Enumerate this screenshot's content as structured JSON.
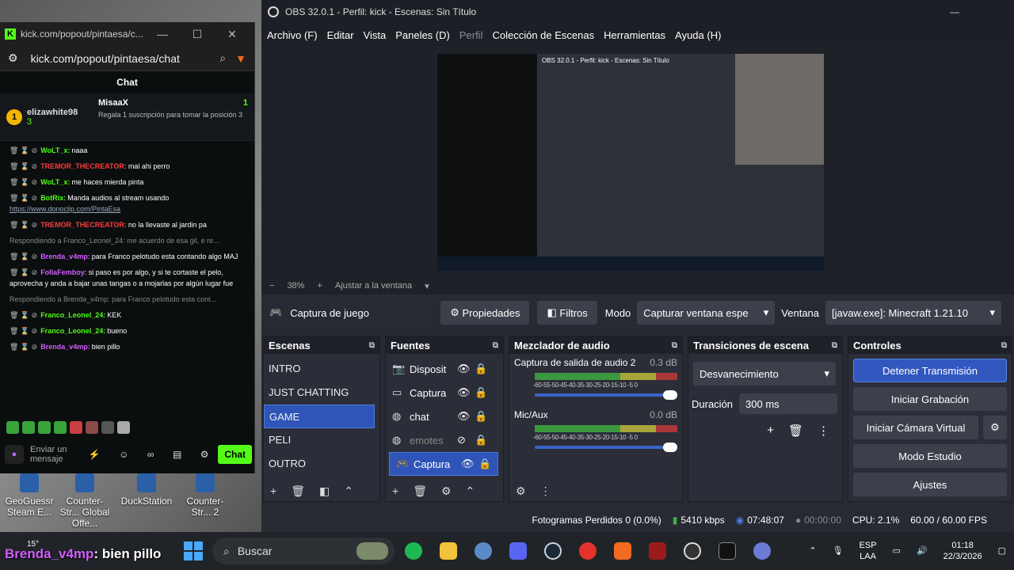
{
  "kick": {
    "window_title": "kick.com/popout/pintaesa/c...",
    "url": "kick.com/popout/pintaesa/chat",
    "chat_header": "Chat",
    "gift1": {
      "rank": "1",
      "name": "elizawhite98",
      "count": "3"
    },
    "gift2": {
      "name": "MisaaX",
      "count": "1",
      "text": "Regala 1 suscripción para tomar la posición 3"
    },
    "messages": [
      {
        "user": "WoLT_x:",
        "text": "naaa",
        "color": "#53fc18"
      },
      {
        "user": "TREMOR_THECREATOR:",
        "text": "mal ahi perro",
        "color": "#ff3b3b"
      },
      {
        "user": "WoLT_x:",
        "text": "me haces mierda pinta",
        "color": "#53fc18"
      },
      {
        "user": "BotRix:",
        "text": "Manda audios al stream usando",
        "color": "#53fc18",
        "link": "https://www.donoclip.com/PintaEsa"
      },
      {
        "user": "TREMOR_THECREATOR:",
        "text": "no la llevaste al jardin pa",
        "color": "#ff3b3b"
      },
      {
        "reply": "Respondiendo a Franco_Leonel_24: me acuerdo de esa gil, e re..."
      },
      {
        "user": "Brenda_v4mp:",
        "text": "para Franco pelotudo esta contando algo MAJ",
        "color": "#d15eff"
      },
      {
        "user": "FollaFemboy:",
        "text": "si paso es por algo, y si te cortaste el pelo, aprovecha y anda a bajar unas tangas o a mojarlas por algún lugar fue",
        "color": "#d15eff"
      },
      {
        "reply": "Respondiendo a Brenda_v4mp: para Franco pelotudo esta cont..."
      },
      {
        "user": "Franco_Leonel_24:",
        "text": "KEK",
        "color": "#53fc18"
      },
      {
        "user": "Franco_Leonel_24:",
        "text": "bueno",
        "color": "#53fc18"
      },
      {
        "user": "Brenda_v4mp:",
        "text": "bien pillo",
        "color": "#d15eff"
      }
    ],
    "input_placeholder": "Enviar un mensaje",
    "send_label": "Chat"
  },
  "desktop_icons": [
    "GeoGuessr Steam E...",
    "Counter-Str... Global Offe...",
    "DuckStation",
    "Counter-Str... 2"
  ],
  "obs": {
    "title": "OBS 32.0.1 - Perfil: kick - Escenas: Sin Título",
    "menu": [
      "Archivo (F)",
      "Editar",
      "Vista",
      "Paneles (D)",
      "Perfil",
      "Colección de Escenas",
      "Herramientas",
      "Ayuda (H)"
    ],
    "zoom": "38%",
    "fit": "Ajustar a la ventana",
    "source_name": "Captura de juego",
    "properties": "Propiedades",
    "filters": "Filtros",
    "mode_label": "Modo",
    "mode_value": "Capturar ventana espe",
    "window_label": "Ventana",
    "window_value": "[javaw.exe]: Minecraft 1.21.10",
    "scenes_title": "Escenas",
    "scenes": [
      "INTRO",
      "JUST CHATTING",
      "GAME",
      "PELI",
      "OUTRO"
    ],
    "active_scene": "GAME",
    "sources_title": "Fuentes",
    "sources": [
      "Disposit",
      "Captura",
      "chat",
      "emotes",
      "Captura"
    ],
    "mixer_title": "Mezclador de audio",
    "mixer": [
      {
        "name": "Captura de salida de audio 2",
        "db": "0.3 dB"
      },
      {
        "name": "Mic/Aux",
        "db": "0.0 dB"
      }
    ],
    "meter_ticks": "-60-55-50-45-40-35-30-25-20-15-10 -5  0",
    "transitions_title": "Transiciones de escena",
    "transition": "Desvanecimiento",
    "duration_label": "Duración",
    "duration": "300 ms",
    "controls_title": "Controles",
    "controls": [
      "Detener Transmisión",
      "Iniciar Grabación",
      "Iniciar Cámara Virtual",
      "Modo Estudio",
      "Ajustes"
    ],
    "status": {
      "dropped": "Fotogramas Perdidos 0 (0.0%)",
      "bitrate": "5410 kbps",
      "live": "07:48:07",
      "rec": "00:00:00",
      "cpu": "CPU: 2.1%",
      "fps": "60.00 / 60.00 FPS"
    },
    "preview_mini_title": "OBS 32.0.1 - Perfil: kick - Escenas: Sin Título"
  },
  "taskbar": {
    "overlay_user": "Brenda_v4mp",
    "overlay_text": ": bien pillo",
    "temp": "15°",
    "search": "Buscar",
    "lang1": "ESP",
    "lang2": "LAA",
    "time": "01:18",
    "date": "22/3/2026"
  }
}
